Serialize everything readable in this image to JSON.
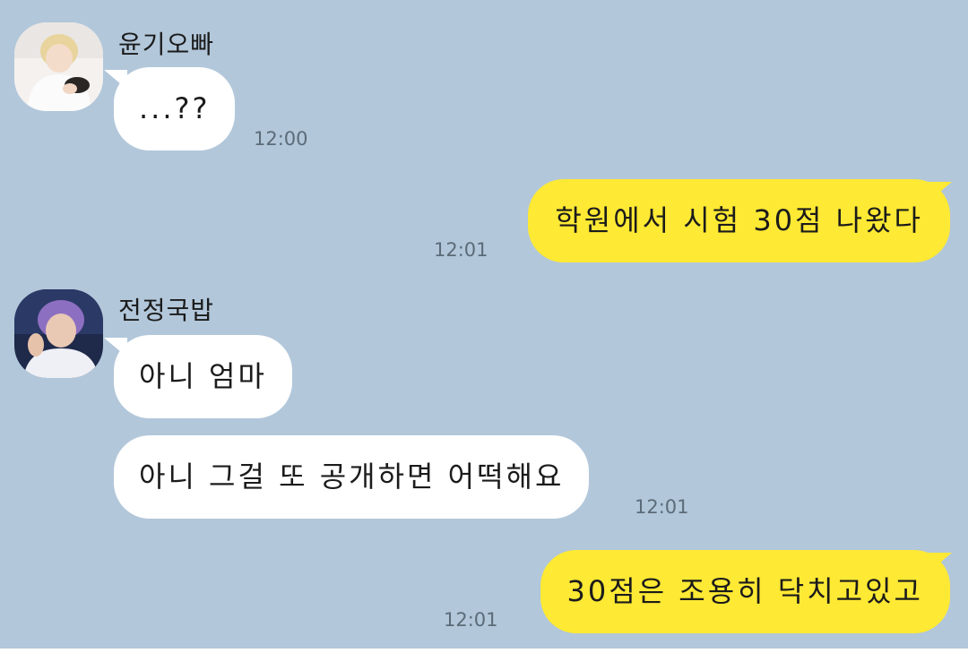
{
  "chat": {
    "messages": [
      {
        "sender": "윤기오빠",
        "text": "...??",
        "time": "12:00"
      },
      {
        "text": "학원에서 시험 30점 나왔다",
        "time": "12:01"
      },
      {
        "sender": "전정국밥",
        "text": "아니 엄마"
      },
      {
        "text": "아니 그걸 또 공개하면 어떡해요",
        "time": "12:01"
      },
      {
        "text": "30점은 조용히 닥치고있고",
        "time": "12:01"
      }
    ]
  },
  "colors": {
    "background": "#b2c7da",
    "incoming_bubble": "#ffffff",
    "outgoing_bubble": "#fee934"
  }
}
